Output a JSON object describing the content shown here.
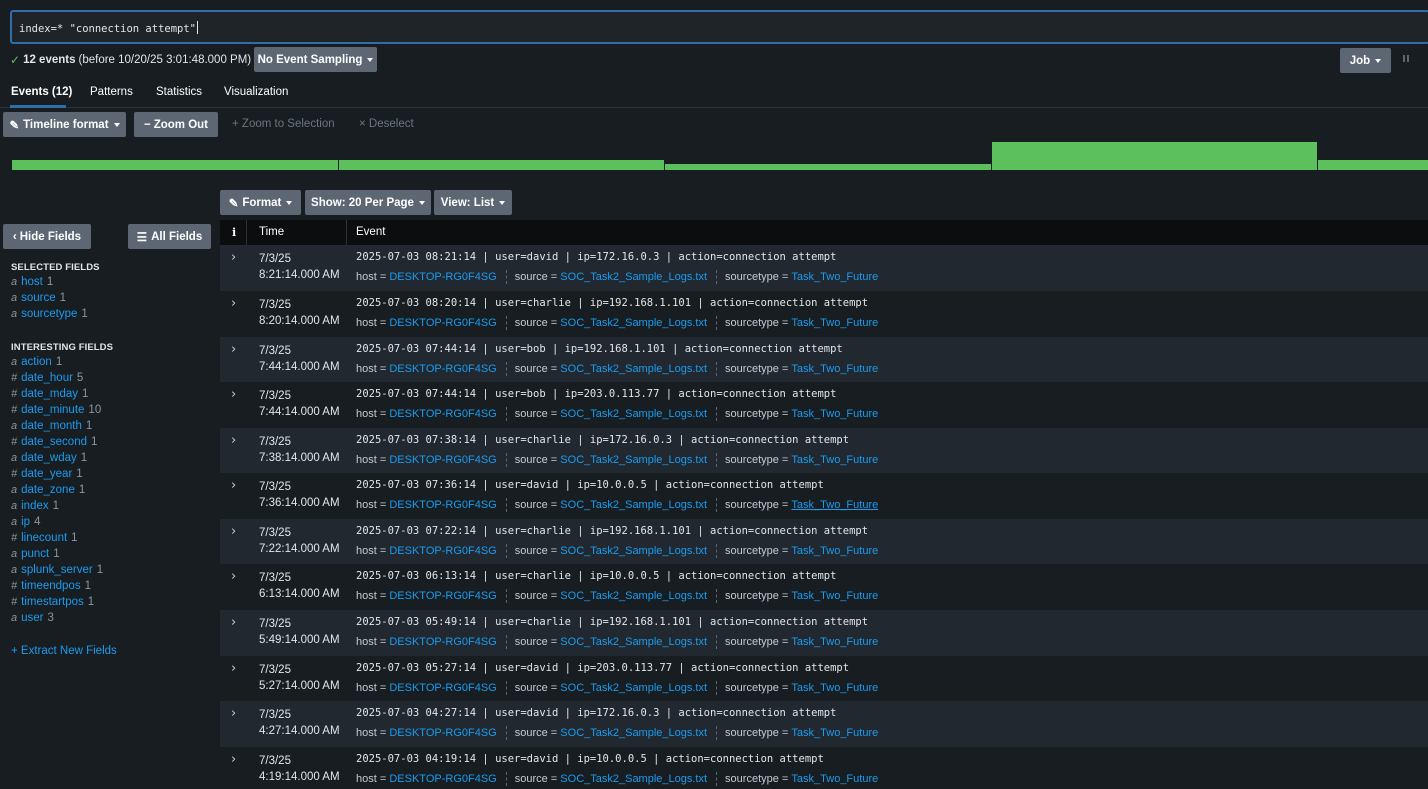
{
  "search": {
    "query": "index=* \"connection attempt\""
  },
  "status": {
    "count": "12 events",
    "detail": "(before 10/20/25 3:01:48.000 PM)",
    "sampling": "No Event Sampling",
    "job": "Job"
  },
  "tabs": [
    "Events (12)",
    "Patterns",
    "Statistics",
    "Visualization"
  ],
  "toolbar": {
    "timeline_format": "Timeline format",
    "zoom_out": "Zoom Out",
    "zoom_selection": "Zoom to Selection",
    "deselect": "Deselect"
  },
  "timeline_levels": [
    0.35,
    0.35,
    0.2,
    1.0,
    0.35
  ],
  "results_toolbar": {
    "format": "Format",
    "show": "Show: 20 Per Page",
    "view": "View: List"
  },
  "sidebar": {
    "hide_fields": "Hide Fields",
    "all_fields": "All Fields",
    "selected_title": "SELECTED FIELDS",
    "selected": [
      {
        "type": "a",
        "name": "host",
        "count": "1"
      },
      {
        "type": "a",
        "name": "source",
        "count": "1"
      },
      {
        "type": "a",
        "name": "sourcetype",
        "count": "1"
      }
    ],
    "interesting_title": "INTERESTING FIELDS",
    "interesting": [
      {
        "type": "a",
        "name": "action",
        "count": "1"
      },
      {
        "type": "#",
        "name": "date_hour",
        "count": "5"
      },
      {
        "type": "#",
        "name": "date_mday",
        "count": "1"
      },
      {
        "type": "#",
        "name": "date_minute",
        "count": "10"
      },
      {
        "type": "a",
        "name": "date_month",
        "count": "1"
      },
      {
        "type": "#",
        "name": "date_second",
        "count": "1"
      },
      {
        "type": "a",
        "name": "date_wday",
        "count": "1"
      },
      {
        "type": "#",
        "name": "date_year",
        "count": "1"
      },
      {
        "type": "a",
        "name": "date_zone",
        "count": "1"
      },
      {
        "type": "a",
        "name": "index",
        "count": "1"
      },
      {
        "type": "a",
        "name": "ip",
        "count": "4"
      },
      {
        "type": "#",
        "name": "linecount",
        "count": "1"
      },
      {
        "type": "a",
        "name": "punct",
        "count": "1"
      },
      {
        "type": "a",
        "name": "splunk_server",
        "count": "1"
      },
      {
        "type": "#",
        "name": "timeendpos",
        "count": "1"
      },
      {
        "type": "#",
        "name": "timestartpos",
        "count": "1"
      },
      {
        "type": "a",
        "name": "user",
        "count": "3"
      }
    ],
    "extract": "+ Extract New Fields"
  },
  "table": {
    "headers": {
      "info": "i",
      "time": "Time",
      "event": "Event"
    },
    "meta_labels": {
      "host": "host =",
      "source": "source =",
      "sourcetype": "sourcetype ="
    },
    "rows": [
      {
        "date": "7/3/25",
        "time": "8:21:14.000 AM",
        "raw": "2025-07-03 08:21:14 | user=david | ip=172.16.0.3 | action=connection attempt",
        "host": "DESKTOP-RG0F4SG",
        "source": "SOC_Task2_Sample_Logs.txt",
        "sourcetype": "Task_Two_Future"
      },
      {
        "date": "7/3/25",
        "time": "8:20:14.000 AM",
        "raw": "2025-07-03 08:20:14 | user=charlie | ip=192.168.1.101 | action=connection attempt",
        "host": "DESKTOP-RG0F4SG",
        "source": "SOC_Task2_Sample_Logs.txt",
        "sourcetype": "Task_Two_Future"
      },
      {
        "date": "7/3/25",
        "time": "7:44:14.000 AM",
        "raw": "2025-07-03 07:44:14 | user=bob | ip=192.168.1.101 | action=connection attempt",
        "host": "DESKTOP-RG0F4SG",
        "source": "SOC_Task2_Sample_Logs.txt",
        "sourcetype": "Task_Two_Future"
      },
      {
        "date": "7/3/25",
        "time": "7:44:14.000 AM",
        "raw": "2025-07-03 07:44:14 | user=bob | ip=203.0.113.77 | action=connection attempt",
        "host": "DESKTOP-RG0F4SG",
        "source": "SOC_Task2_Sample_Logs.txt",
        "sourcetype": "Task_Two_Future"
      },
      {
        "date": "7/3/25",
        "time": "7:38:14.000 AM",
        "raw": "2025-07-03 07:38:14 | user=charlie | ip=172.16.0.3 | action=connection attempt",
        "host": "DESKTOP-RG0F4SG",
        "source": "SOC_Task2_Sample_Logs.txt",
        "sourcetype": "Task_Two_Future"
      },
      {
        "date": "7/3/25",
        "time": "7:36:14.000 AM",
        "raw": "2025-07-03 07:36:14 | user=david | ip=10.0.0.5 | action=connection attempt",
        "host": "DESKTOP-RG0F4SG",
        "source": "SOC_Task2_Sample_Logs.txt",
        "sourcetype": "Task_Two_Future",
        "hover": true
      },
      {
        "date": "7/3/25",
        "time": "7:22:14.000 AM",
        "raw": "2025-07-03 07:22:14 | user=charlie | ip=192.168.1.101 | action=connection attempt",
        "host": "DESKTOP-RG0F4SG",
        "source": "SOC_Task2_Sample_Logs.txt",
        "sourcetype": "Task_Two_Future"
      },
      {
        "date": "7/3/25",
        "time": "6:13:14.000 AM",
        "raw": "2025-07-03 06:13:14 | user=charlie | ip=10.0.0.5 | action=connection attempt",
        "host": "DESKTOP-RG0F4SG",
        "source": "SOC_Task2_Sample_Logs.txt",
        "sourcetype": "Task_Two_Future"
      },
      {
        "date": "7/3/25",
        "time": "5:49:14.000 AM",
        "raw": "2025-07-03 05:49:14 | user=charlie | ip=192.168.1.101 | action=connection attempt",
        "host": "DESKTOP-RG0F4SG",
        "source": "SOC_Task2_Sample_Logs.txt",
        "sourcetype": "Task_Two_Future"
      },
      {
        "date": "7/3/25",
        "time": "5:27:14.000 AM",
        "raw": "2025-07-03 05:27:14 | user=david | ip=203.0.113.77 | action=connection attempt",
        "host": "DESKTOP-RG0F4SG",
        "source": "SOC_Task2_Sample_Logs.txt",
        "sourcetype": "Task_Two_Future"
      },
      {
        "date": "7/3/25",
        "time": "4:27:14.000 AM",
        "raw": "2025-07-03 04:27:14 | user=david | ip=172.16.0.3 | action=connection attempt",
        "host": "DESKTOP-RG0F4SG",
        "source": "SOC_Task2_Sample_Logs.txt",
        "sourcetype": "Task_Two_Future"
      },
      {
        "date": "7/3/25",
        "time": "4:19:14.000 AM",
        "raw": "2025-07-03 04:19:14 | user=david | ip=10.0.0.5 | action=connection attempt",
        "host": "DESKTOP-RG0F4SG",
        "source": "SOC_Task2_Sample_Logs.txt",
        "sourcetype": "Task_Two_Future"
      }
    ]
  }
}
